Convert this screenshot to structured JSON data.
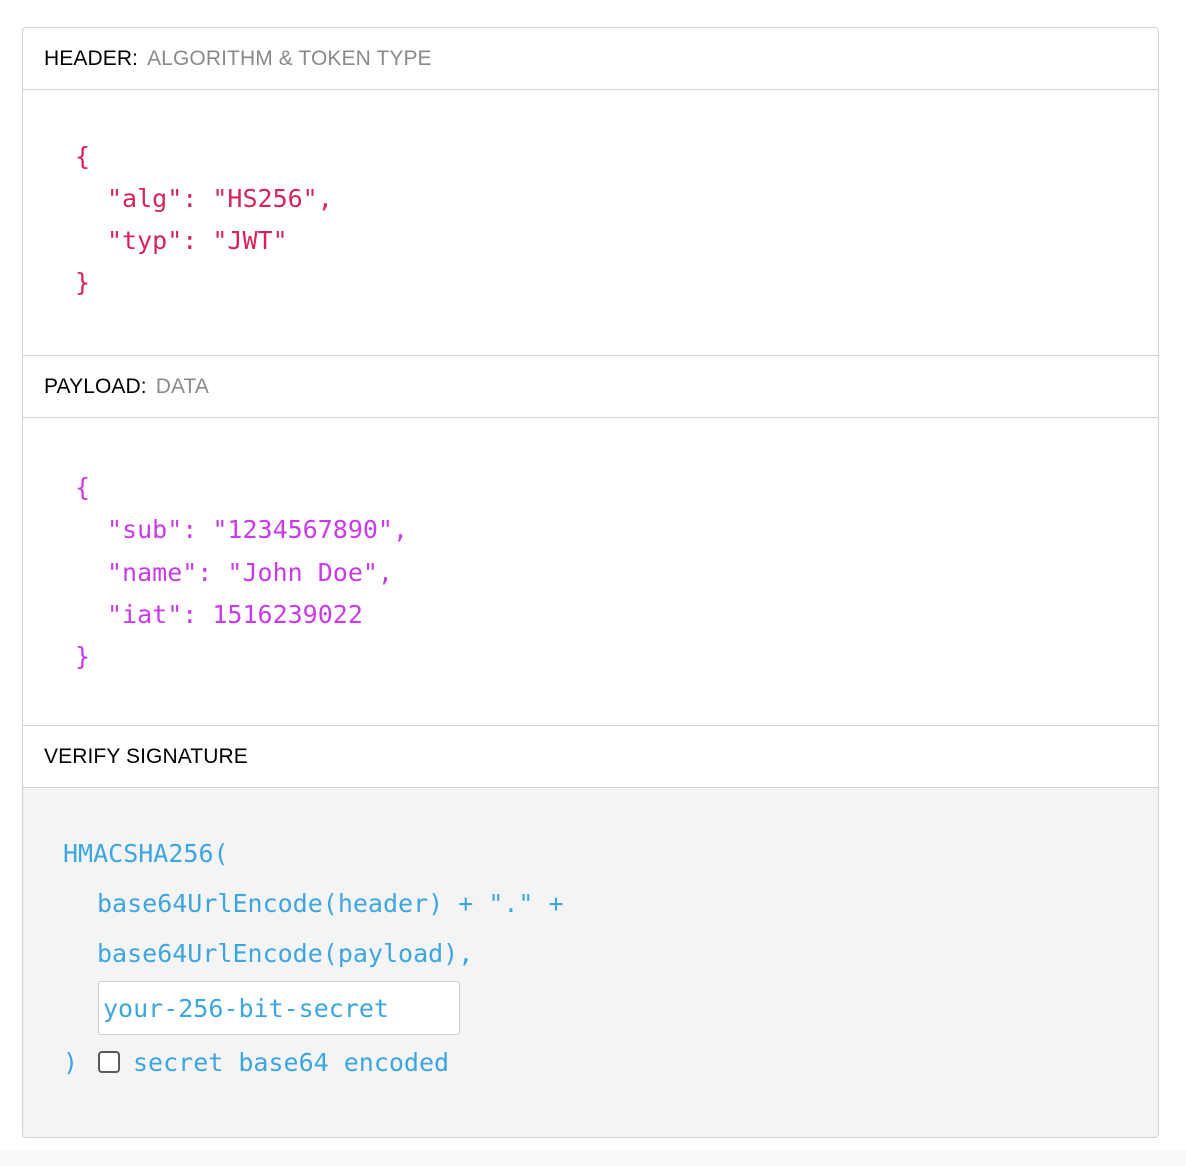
{
  "header": {
    "label": "HEADER:",
    "sublabel": "ALGORITHM & TOKEN TYPE",
    "code": {
      "open": "{",
      "line1": "\"alg\": \"HS256\",",
      "line2": "\"typ\": \"JWT\"",
      "close": "}"
    }
  },
  "payload": {
    "label": "PAYLOAD:",
    "sublabel": "DATA",
    "code": {
      "open": "{",
      "line1": "\"sub\": \"1234567890\",",
      "line2": "\"name\": \"John Doe\",",
      "line3": "\"iat\": 1516239022",
      "close": "}"
    }
  },
  "verify": {
    "label": "VERIFY SIGNATURE",
    "fn_open": "HMACSHA256(",
    "arg1": "base64UrlEncode(header) + \".\" +",
    "arg2": "base64UrlEncode(payload),",
    "secret_placeholder": "your-256-bit-secret",
    "fn_close": ")",
    "checkbox_label": "secret base64 encoded",
    "checkbox_checked": false
  },
  "colors": {
    "header_code": "#d6245a",
    "payload_code": "#c93be8",
    "verify_code": "#3ea6de",
    "verify_background": "#f4f4f4"
  }
}
